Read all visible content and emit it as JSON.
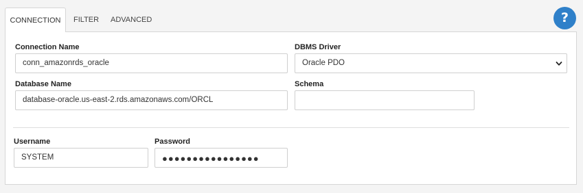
{
  "tabs": [
    {
      "label": "CONNECTION",
      "active": true
    },
    {
      "label": "FILTER",
      "active": false
    },
    {
      "label": "ADVANCED",
      "active": false
    }
  ],
  "help": {
    "label": "?",
    "icon": "help-icon",
    "color": "#2f80c9"
  },
  "form": {
    "connection_name": {
      "label": "Connection Name",
      "value": "conn_amazonrds_oracle"
    },
    "dbms_driver": {
      "label": "DBMS Driver",
      "value": "Oracle PDO",
      "icon": "chevron-down-icon"
    },
    "database_name": {
      "label": "Database Name",
      "value": "database-oracle.us-east-2.rds.amazonaws.com/ORCL"
    },
    "schema": {
      "label": "Schema",
      "value": ""
    },
    "username": {
      "label": "Username",
      "value": "SYSTEM"
    },
    "password": {
      "label": "Password",
      "value": "●●●●●●●●●●●●●●●●"
    }
  }
}
